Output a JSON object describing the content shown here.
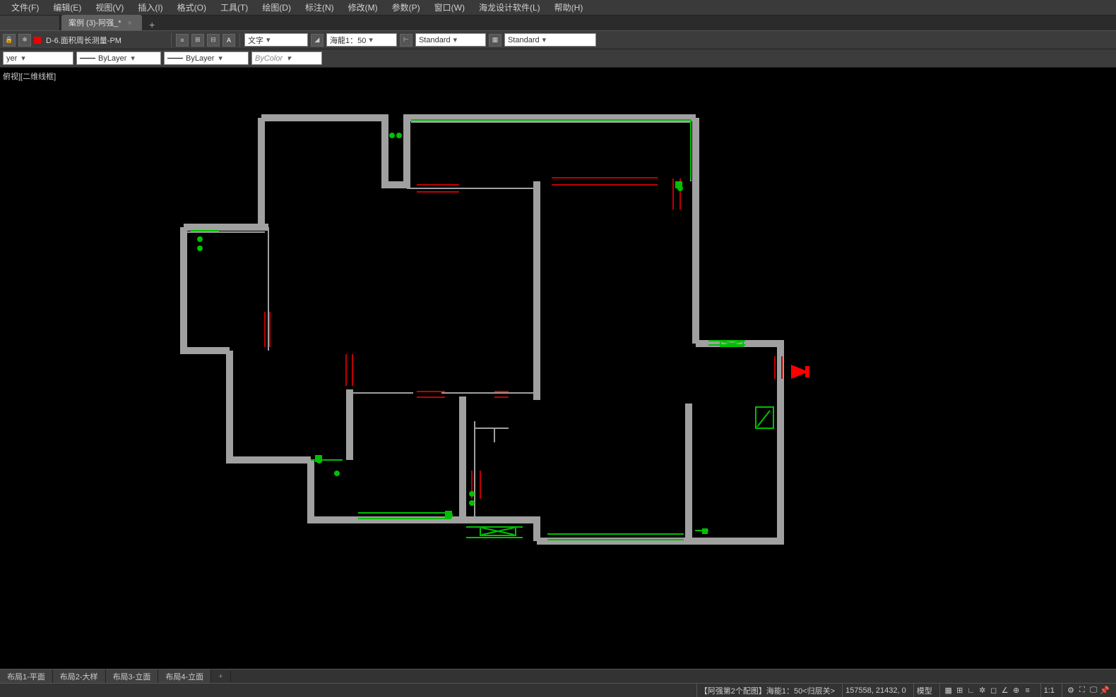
{
  "menu": {
    "file": "文件(F)",
    "edit": "编辑(E)",
    "view": "视图(V)",
    "insert": "插入(I)",
    "format": "格式(O)",
    "tools": "工具(T)",
    "draw": "绘图(D)",
    "annotate": "标注(N)",
    "modify": "修改(M)",
    "param": "参数(P)",
    "window": "窗口(W)",
    "hailong": "海龙设计软件(L)",
    "help": "帮助(H)"
  },
  "tabs": {
    "active": "案例 (3)-阿强_*"
  },
  "toolbar": {
    "breadcrumb": "D-6.面积周长测量-PM",
    "textStyle": "文字",
    "scale": "海龍1：50",
    "dimStyle1": "Standard",
    "dimStyle2": "Standard"
  },
  "properties": {
    "layer": "yer",
    "linetype": "ByLayer",
    "color": "ByColor"
  },
  "viewport": {
    "label": "俯视][二维线框]"
  },
  "layouts": [
    "布局1-平面",
    "布局2-大样",
    "布局3-立面",
    "布局4-立面"
  ],
  "status": {
    "phase": "【阿强第2个配图】海能1：50<归层关>",
    "coords": "157558, 21432, 0",
    "space": "模型",
    "ratio": "1:1"
  }
}
